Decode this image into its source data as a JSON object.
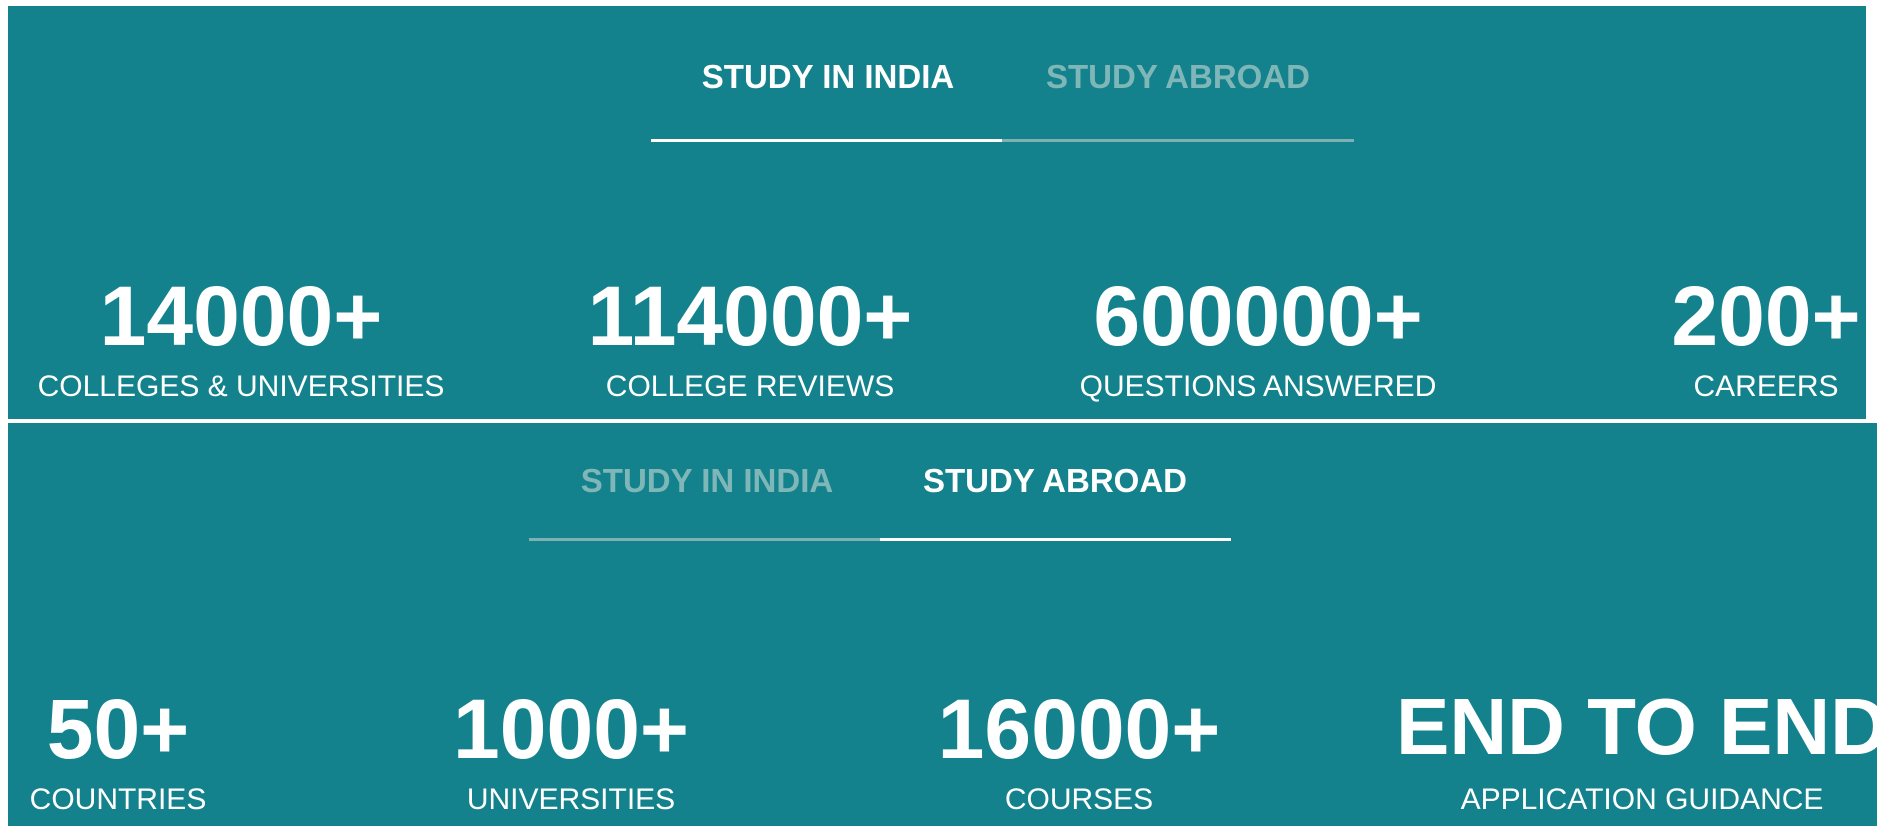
{
  "panels": {
    "india": {
      "tabs": {
        "study_in_india": "STUDY IN INDIA",
        "study_abroad": "STUDY ABROAD",
        "active": "study_in_india"
      },
      "stats": [
        {
          "number": "14000+",
          "label": "COLLEGES & UNIVERSITIES"
        },
        {
          "number": "114000+",
          "label": "COLLEGE REVIEWS"
        },
        {
          "number": "600000+",
          "label": "QUESTIONS ANSWERED"
        },
        {
          "number": "200+",
          "label": "CAREERS"
        }
      ]
    },
    "abroad": {
      "tabs": {
        "study_in_india": "STUDY IN INDIA",
        "study_abroad": "STUDY ABROAD",
        "active": "study_abroad"
      },
      "stats": [
        {
          "number": "50+",
          "label": "COUNTRIES"
        },
        {
          "number": "1000+",
          "label": "UNIVERSITIES"
        },
        {
          "number": "16000+",
          "label": "COURSES"
        },
        {
          "number": "END TO END",
          "label": "APPLICATION GUIDANCE"
        }
      ]
    }
  },
  "colors": {
    "background": "#14828c",
    "text_active": "#ffffff",
    "text_inactive": "#7fb6b8",
    "underline_inactive": "#7fb0b2"
  }
}
